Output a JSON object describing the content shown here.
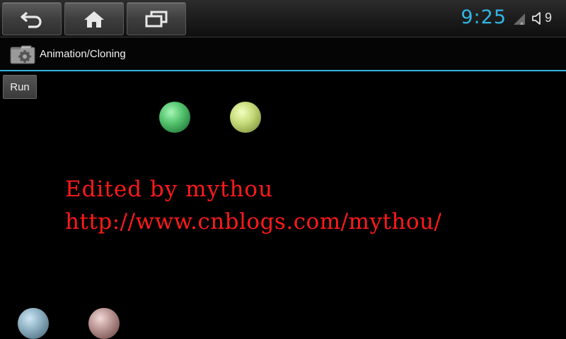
{
  "system_bar": {
    "time": "9:25",
    "volume_level": "9",
    "nav_buttons": [
      "back",
      "home",
      "recent-apps"
    ],
    "icons": [
      "back-icon",
      "home-icon",
      "recent-apps-icon",
      "signal-icon",
      "volume-icon"
    ],
    "accent_color": "#33b5e5"
  },
  "action_bar": {
    "title": "Animation/Cloning",
    "icon": "app-icon"
  },
  "content": {
    "run_button_label": "Run",
    "balls": [
      {
        "name": "ball-green",
        "color": "#55c56f"
      },
      {
        "name": "ball-yellow",
        "color": "#c6dc7a"
      },
      {
        "name": "ball-blue",
        "color": "#8fb2c4"
      },
      {
        "name": "ball-pink",
        "color": "#b99593"
      }
    ],
    "watermark": {
      "line1": "Edited by mythou",
      "line2": "http://www.cnblogs.com/mythou/",
      "color": "#ff1a1a"
    }
  }
}
